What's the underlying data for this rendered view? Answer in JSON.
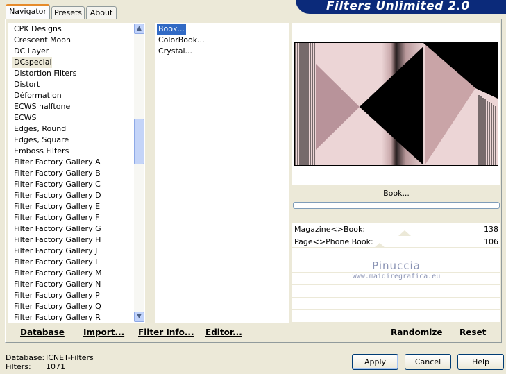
{
  "tabs": [
    {
      "label": "Navigator",
      "active": true
    },
    {
      "label": "Presets",
      "active": false
    },
    {
      "label": "About",
      "active": false
    }
  ],
  "banner": {
    "title": "Filters Unlimited 2.0"
  },
  "categories": {
    "items": [
      "CPK Designs",
      "Crescent Moon",
      "DC Layer",
      "DCspecial",
      "Distortion Filters",
      "Distort",
      "Déformation",
      "ECWS halftone",
      "ECWS",
      "Edges, Round",
      "Edges, Square",
      "Emboss Filters",
      "Filter Factory Gallery A",
      "Filter Factory Gallery B",
      "Filter Factory Gallery C",
      "Filter Factory Gallery D",
      "Filter Factory Gallery E",
      "Filter Factory Gallery F",
      "Filter Factory Gallery G",
      "Filter Factory Gallery H",
      "Filter Factory Gallery J",
      "Filter Factory Gallery L",
      "Filter Factory Gallery M",
      "Filter Factory Gallery N",
      "Filter Factory Gallery P",
      "Filter Factory Gallery Q",
      "Filter Factory Gallery R"
    ],
    "selected_index": 3
  },
  "filters": {
    "items": [
      "Book...",
      "ColorBook...",
      "Crystal..."
    ],
    "selected_index": 0
  },
  "preview": {
    "filter_name": "Book..."
  },
  "params": [
    {
      "label": "Magazine<>Book:",
      "value": "138",
      "level": 138
    },
    {
      "label": "Page<>Phone Book:",
      "value": "106",
      "level": 106
    }
  ],
  "watermark": {
    "name": "Pinuccia",
    "url": "www.maidiregrafica.eu"
  },
  "left_toolbar": {
    "database": "Database",
    "import": "Import...",
    "filter_info": "Filter Info...",
    "editor": "Editor..."
  },
  "right_toolbar": {
    "randomize": "Randomize",
    "reset": "Reset"
  },
  "footer": {
    "database_label": "Database:",
    "database_value": "ICNET-Filters",
    "filters_label": "Filters:",
    "filters_value": "1071"
  },
  "buttons": {
    "apply": "Apply",
    "cancel": "Cancel",
    "help": "Help"
  },
  "colors": {
    "banner": "#0b2a7a",
    "selection": "#316ac5",
    "preview_pink_light": "#ecd5d6",
    "preview_pink_dark": "#c9a4a7",
    "preview_mauve": "#b8939a"
  }
}
